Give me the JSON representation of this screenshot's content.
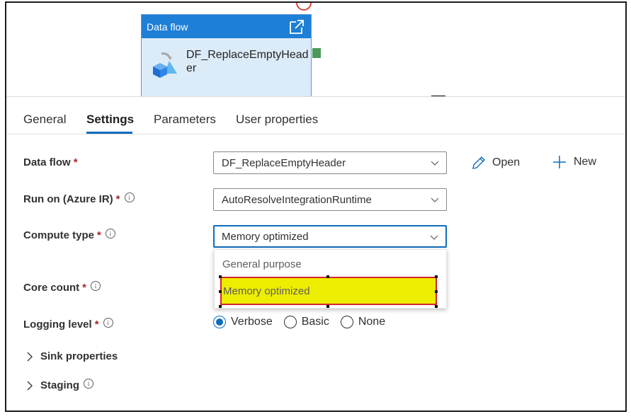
{
  "canvas": {
    "activity": {
      "header_label": "Data flow",
      "name": "DF_ReplaceEmptyHeader",
      "header_color": "#1e7fd6"
    },
    "icons": [
      "external-link-icon",
      "data-flow-icon"
    ]
  },
  "tabs": [
    {
      "label": "General"
    },
    {
      "label": "Settings",
      "active": true
    },
    {
      "label": "Parameters"
    },
    {
      "label": "User properties"
    }
  ],
  "settings": {
    "data_flow": {
      "label": "Data flow",
      "required_mark": "*",
      "value": "DF_ReplaceEmptyHeader",
      "open_label": "Open",
      "new_label": "New"
    },
    "run_on": {
      "label": "Run on (Azure IR)",
      "required_mark": "*",
      "value": "AutoResolveIntegrationRuntime"
    },
    "compute_type": {
      "label": "Compute type",
      "required_mark": "*",
      "value": "Memory optimized",
      "options": [
        "General purpose",
        "Memory optimized"
      ]
    },
    "core_count": {
      "label": "Core count",
      "required_mark": "*"
    },
    "logging_level": {
      "label": "Logging level",
      "required_mark": "*",
      "options": [
        "Verbose",
        "Basic",
        "None"
      ],
      "selected": "Verbose"
    },
    "sink_properties": {
      "label": "Sink properties"
    },
    "staging": {
      "label": "Staging"
    }
  },
  "colors": {
    "accent": "#0f6cbd",
    "highlight": "#eded00",
    "highlight_border": "#d4242a",
    "required": "#a4262c"
  }
}
